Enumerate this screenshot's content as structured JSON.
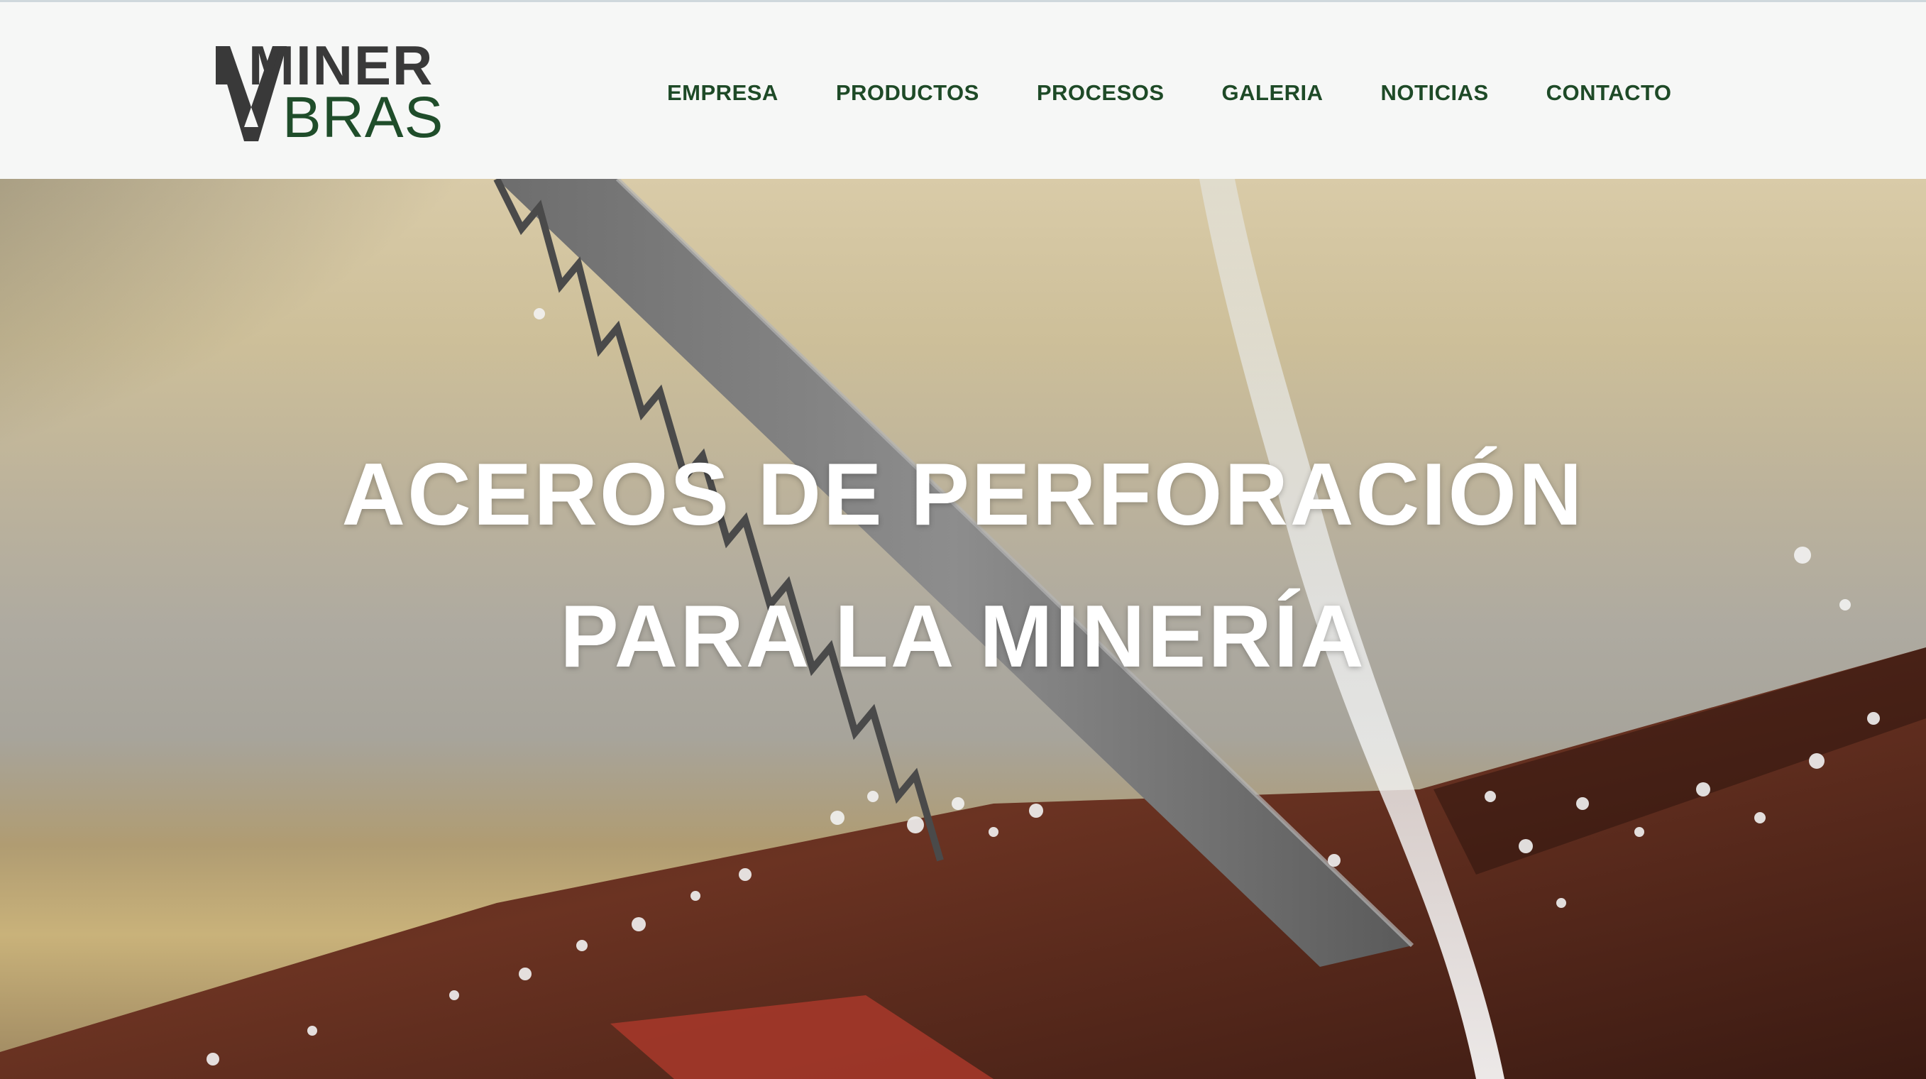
{
  "brand": {
    "logo_top": "MINER",
    "logo_bottom": "BRAS",
    "colors": {
      "logo_dark": "#393939",
      "logo_green": "#1f4d2a",
      "nav_green": "#1e4a27"
    }
  },
  "nav": {
    "items": [
      {
        "label": "EMPRESA"
      },
      {
        "label": "PRODUCTOS"
      },
      {
        "label": "PROCESOS"
      },
      {
        "label": "GALERIA"
      },
      {
        "label": "NOTICIAS"
      },
      {
        "label": "CONTACTO"
      }
    ]
  },
  "hero": {
    "title_line1": "ACEROS DE PERFORACIÓN",
    "title_line2": "PARA LA MINERÍA",
    "image_subject": "bandsaw blade cutting metal bar with coolant and chips"
  }
}
